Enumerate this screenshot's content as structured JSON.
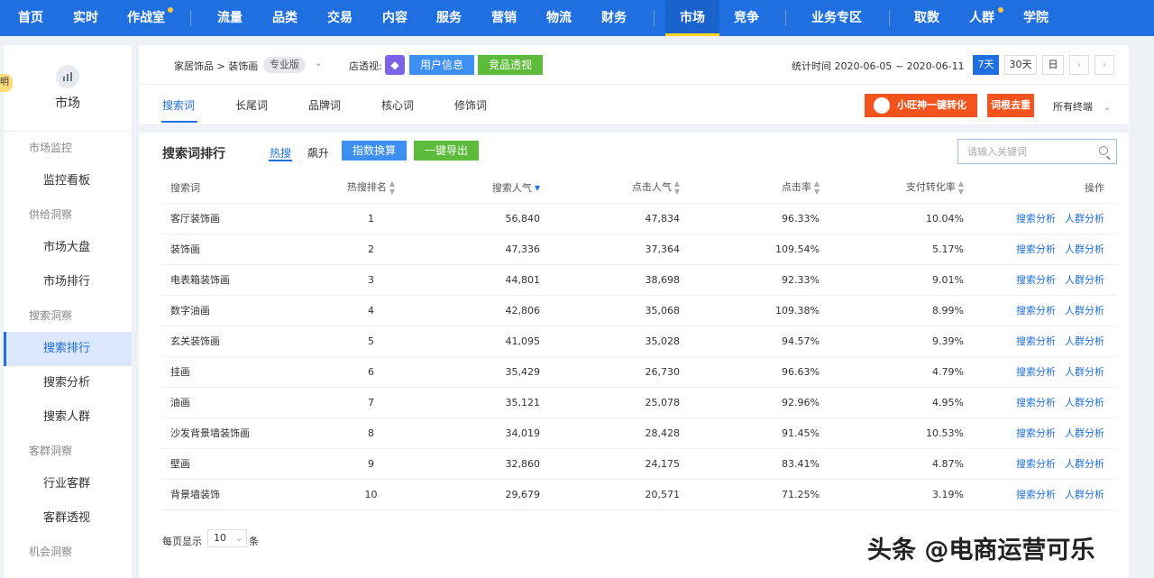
{
  "topnav": {
    "items": [
      {
        "label": "首页"
      },
      {
        "label": "实时"
      },
      {
        "label": "作战室"
      },
      {
        "label": "流量"
      },
      {
        "label": "品类"
      },
      {
        "label": "交易"
      },
      {
        "label": "内容"
      },
      {
        "label": "服务"
      },
      {
        "label": "营销"
      },
      {
        "label": "物流"
      },
      {
        "label": "财务"
      },
      {
        "label": "市场"
      },
      {
        "label": "竞争"
      },
      {
        "label": "业务专区"
      },
      {
        "label": "取数"
      },
      {
        "label": "人群"
      },
      {
        "label": "学院"
      }
    ],
    "active": "市场"
  },
  "sidebar": {
    "badge": "明",
    "title": "市场",
    "groups": [
      {
        "label": "市场监控",
        "items": [
          "监控看板"
        ]
      },
      {
        "label": "供给洞察",
        "items": [
          "市场大盘",
          "市场排行"
        ]
      },
      {
        "label": "搜索洞察",
        "items": [
          "搜索排行",
          "搜索分析",
          "搜索人群"
        ]
      },
      {
        "label": "客群洞察",
        "items": [
          "行业客群",
          "客群透视"
        ]
      },
      {
        "label": "机会洞察",
        "items": []
      }
    ],
    "active_item": "搜索排行"
  },
  "header": {
    "breadcrumb": "家居饰品 > 装饰画",
    "edition": "专业版",
    "shop_label": "店透视:",
    "user_info_button": "用户信息",
    "competitor_button": "竞品透视",
    "stat_time": "统计时间 2020-06-05 ~ 2020-06-11",
    "range_buttons": [
      "7天",
      "30天",
      "日"
    ],
    "tabs": [
      "搜索词",
      "长尾词",
      "品牌词",
      "核心词",
      "修饰词"
    ],
    "convert_button": "小旺神一键转化",
    "dedupe_button": "词根去重",
    "terminal": "所有终端"
  },
  "main": {
    "title": "搜索词排行",
    "segments": [
      "热搜",
      "飙升"
    ],
    "index_button": "指数换算",
    "export_button": "一键导出",
    "search_placeholder": "请输入关键词",
    "columns": [
      "搜索词",
      "热搜排名",
      "搜索人气",
      "点击人气",
      "点击率",
      "支付转化率",
      "操作"
    ],
    "rows": [
      {
        "word": "客厅装饰画",
        "rank": "1",
        "search": "56,840",
        "click": "47,834",
        "ctr": "96.33%",
        "cvr": "10.04%"
      },
      {
        "word": "装饰画",
        "rank": "2",
        "search": "47,336",
        "click": "37,364",
        "ctr": "109.54%",
        "cvr": "5.17%"
      },
      {
        "word": "电表箱装饰画",
        "rank": "3",
        "search": "44,801",
        "click": "38,698",
        "ctr": "92.33%",
        "cvr": "9.01%"
      },
      {
        "word": "数字油画",
        "rank": "4",
        "search": "42,806",
        "click": "35,068",
        "ctr": "109.38%",
        "cvr": "8.99%"
      },
      {
        "word": "玄关装饰画",
        "rank": "5",
        "search": "41,095",
        "click": "35,028",
        "ctr": "94.57%",
        "cvr": "9.39%"
      },
      {
        "word": "挂画",
        "rank": "6",
        "search": "35,429",
        "click": "26,730",
        "ctr": "96.63%",
        "cvr": "4.79%"
      },
      {
        "word": "油画",
        "rank": "7",
        "search": "35,121",
        "click": "25,078",
        "ctr": "92.96%",
        "cvr": "4.95%"
      },
      {
        "word": "沙发背景墙装饰画",
        "rank": "8",
        "search": "34,019",
        "click": "28,428",
        "ctr": "91.45%",
        "cvr": "10.53%"
      },
      {
        "word": "壁画",
        "rank": "9",
        "search": "32,860",
        "click": "24,175",
        "ctr": "83.41%",
        "cvr": "4.87%"
      },
      {
        "word": "背景墙装饰",
        "rank": "10",
        "search": "29,679",
        "click": "20,571",
        "ctr": "71.25%",
        "cvr": "3.19%"
      }
    ],
    "row_actions": [
      "搜索分析",
      "人群分析"
    ],
    "pager": {
      "label": "每页显示",
      "size": "10",
      "unit": "条"
    }
  },
  "watermark": "头条 @电商运营可乐",
  "colors": {
    "brand": "#1f6fe0",
    "green": "#5dbb3b",
    "orange": "#f4531d"
  }
}
